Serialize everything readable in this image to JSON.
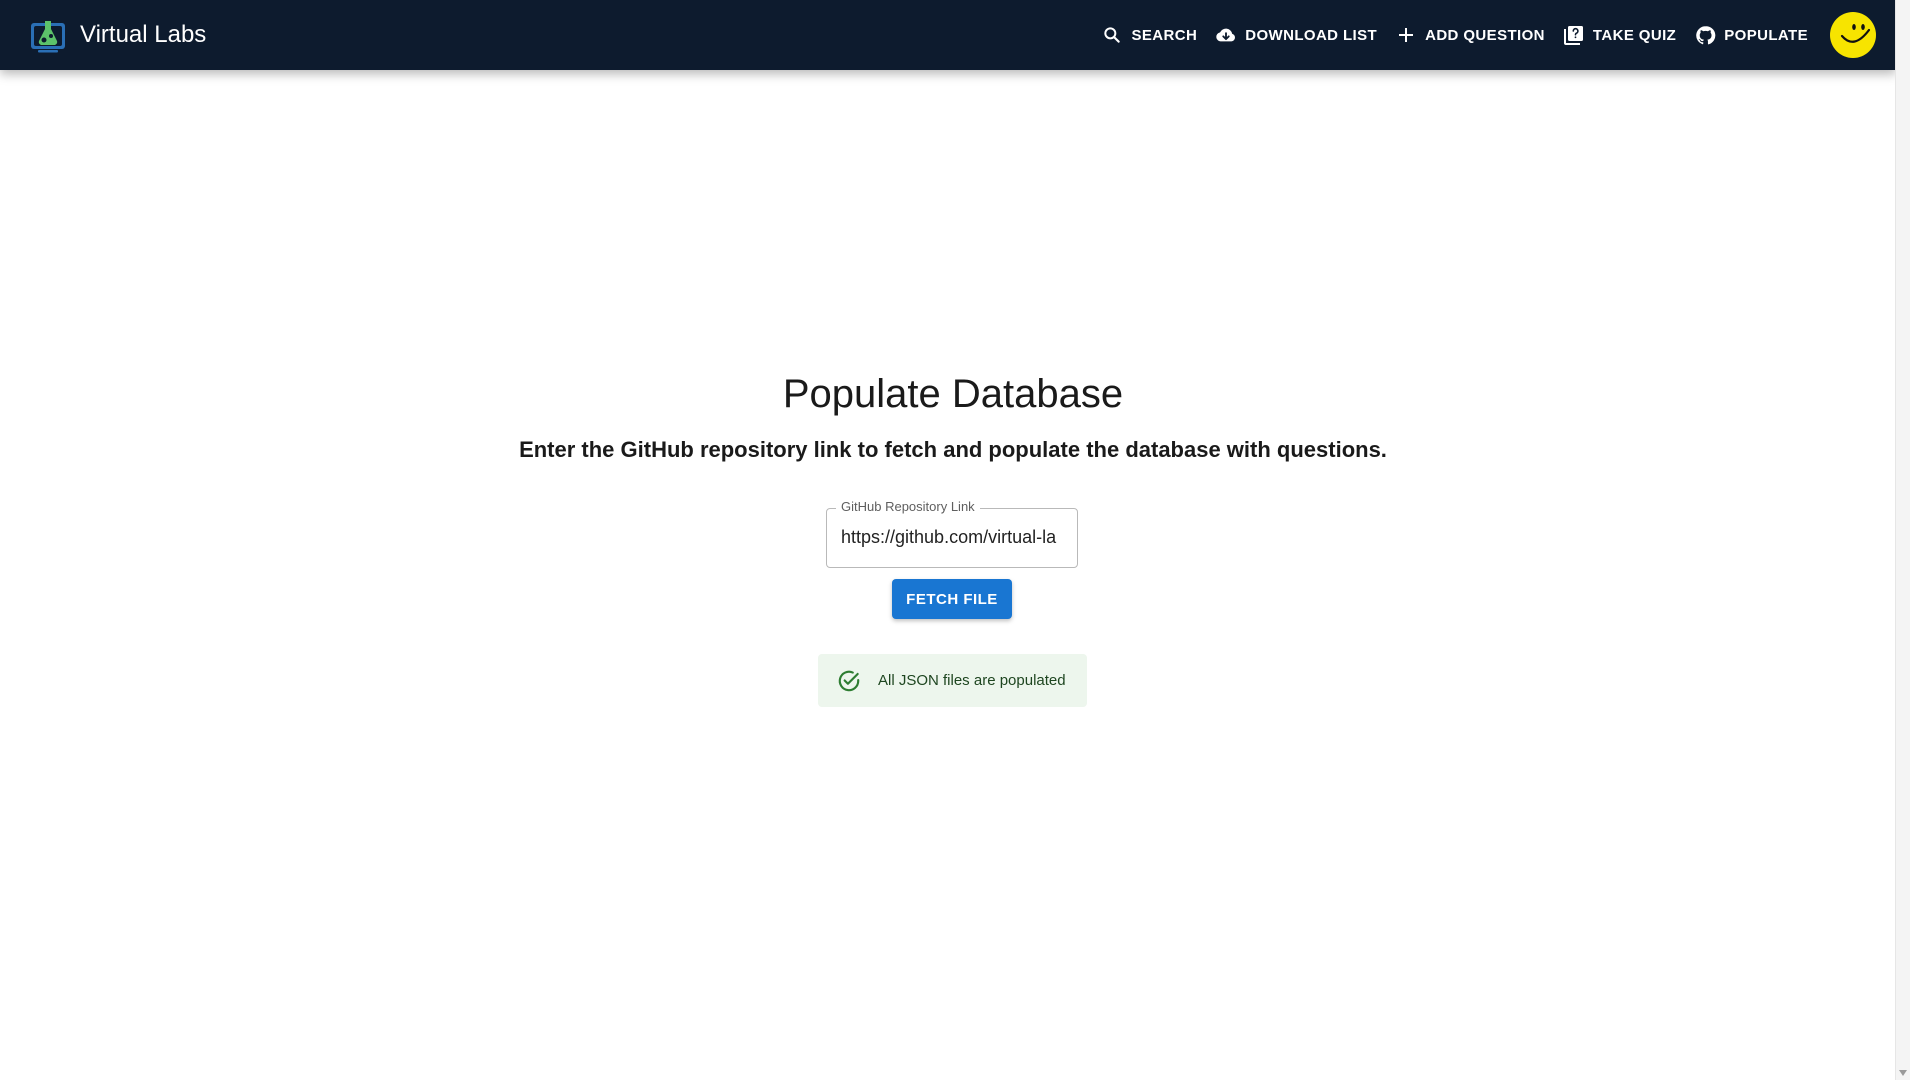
{
  "app": {
    "title": "Virtual Labs"
  },
  "nav": {
    "items": [
      {
        "label": "SEARCH",
        "icon": "search-icon"
      },
      {
        "label": "DOWNLOAD LIST",
        "icon": "cloud-download-icon"
      },
      {
        "label": "ADD QUESTION",
        "icon": "plus-icon"
      },
      {
        "label": "TAKE QUIZ",
        "icon": "quiz-icon"
      },
      {
        "label": "POPULATE",
        "icon": "github-icon"
      }
    ],
    "avatar_icon": "smiley-avatar-icon"
  },
  "main": {
    "title": "Populate Database",
    "subtitle": "Enter the GitHub repository link to fetch and populate the database with questions.",
    "repo_field": {
      "label": "GitHub Repository Link",
      "value": "https://github.com/virtual-la"
    },
    "fetch_button": "FETCH FILE",
    "alert": {
      "icon": "check-circle-icon",
      "text": "All JSON files are populated"
    }
  },
  "colors": {
    "appbar": "#0d1b2e",
    "primary": "#1976d2",
    "success_bg": "#edf6ed",
    "success_icon": "#2e7d32",
    "avatar": "#f7e400"
  }
}
